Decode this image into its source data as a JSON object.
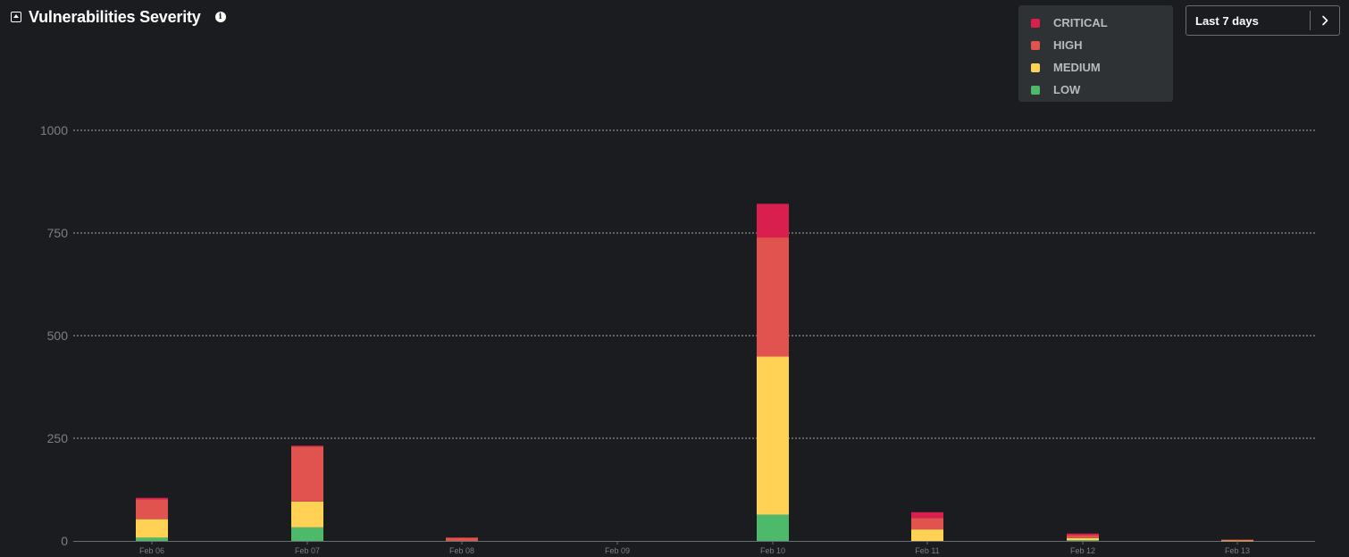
{
  "header": {
    "title": "Vulnerabilities Severity",
    "info_glyph": "i",
    "collapse_icon": "collapse-icon",
    "info_icon": "info-icon"
  },
  "range_selector": {
    "label": "Last 7 days",
    "icon": "chevron-right-icon"
  },
  "chart_data": {
    "type": "bar",
    "stacked": true,
    "categories": [
      "Feb 06",
      "Feb 07",
      "Feb 08",
      "Feb 09",
      "Feb 10",
      "Feb 11",
      "Feb 12",
      "Feb 13"
    ],
    "series": [
      {
        "name": "LOW",
        "color": "#4cb96b",
        "values": [
          8,
          33,
          0,
          0,
          64,
          0,
          2,
          0
        ]
      },
      {
        "name": "MEDIUM",
        "color": "#ffd256",
        "values": [
          45,
          63,
          0,
          0,
          385,
          28,
          5,
          1
        ]
      },
      {
        "name": "HIGH",
        "color": "#e0534e",
        "values": [
          48,
          134,
          8,
          0,
          290,
          28,
          7,
          2
        ]
      },
      {
        "name": "CRITICAL",
        "color": "#d81f4e",
        "values": [
          4,
          2,
          0,
          0,
          82,
          14,
          4,
          0
        ]
      }
    ],
    "legend_order": [
      "CRITICAL",
      "HIGH",
      "MEDIUM",
      "LOW"
    ],
    "yticks": [
      0,
      250,
      500,
      750,
      1000
    ],
    "ylim": [
      0,
      1000
    ],
    "grid": true,
    "legend_position": "top-right",
    "xlabel": "",
    "ylabel": "",
    "title": "Vulnerabilities Severity"
  },
  "colors": {
    "background": "#1a1c1f",
    "grid": "#c9cbcd",
    "axis": "#6a6d70",
    "tick_text": "#7c7f83",
    "legend_bg": "#2f3235"
  }
}
